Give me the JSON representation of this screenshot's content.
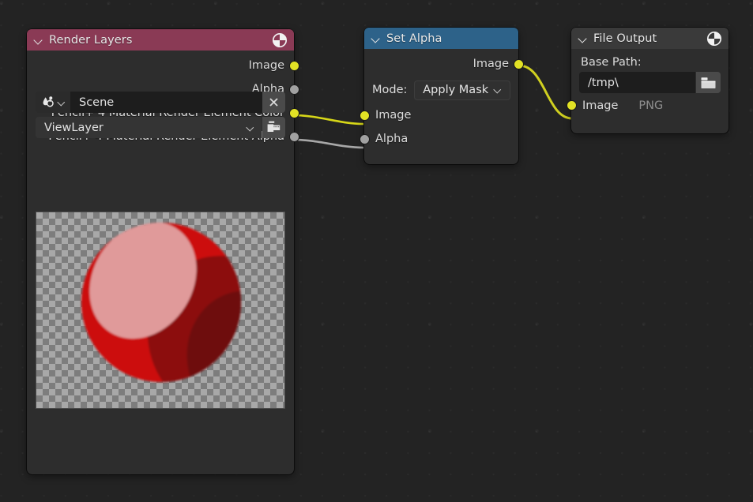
{
  "editor": {
    "background_color": "#232323",
    "grid": "dot-grid"
  },
  "nodes": [
    {
      "id": "render-layers",
      "title": "Render Layers",
      "header_color": "#8a3a55",
      "header_icon": "render-result-icon",
      "outputs": [
        {
          "label": "Image",
          "color": "#e2e225"
        },
        {
          "label": "Alpha",
          "color": "#a1a1a1"
        },
        {
          "label": "Pencil+ 4 Material Render Element Color",
          "color": "#e2e225"
        },
        {
          "label": "Pencil+ 4 Material Render Element Alpha",
          "color": "#a1a1a1"
        }
      ],
      "preview": {
        "name": "render-preview-thumbnail",
        "description": "toon shaded red sphere on transparent checkerboard"
      },
      "scene_field": {
        "icon": "scene-datablock-icon",
        "value": "Scene",
        "clear_label": "×"
      },
      "viewlayer_field": {
        "value": "ViewLayer",
        "side_icon": "view-layer-icon"
      }
    },
    {
      "id": "set-alpha",
      "title": "Set Alpha",
      "header_color": "#2d6289",
      "outputs": [
        {
          "label": "Image",
          "color": "#e2e225"
        }
      ],
      "mode": {
        "label": "Mode:",
        "value": "Apply Mask"
      },
      "inputs": [
        {
          "label": "Image",
          "color": "#e2e225"
        },
        {
          "label": "Alpha",
          "color": "#a1a1a1"
        }
      ]
    },
    {
      "id": "file-output",
      "title": "File Output",
      "header_color": "#3a3a3a",
      "header_icon": "render-result-icon",
      "base_path": {
        "label": "Base Path:",
        "value": "/tmp\\",
        "browse_icon": "folder-icon"
      },
      "inputs": [
        {
          "label": "Image",
          "color": "#e2e225",
          "format": "PNG"
        }
      ]
    }
  ],
  "links": [
    {
      "from": "render-layers.Pencil+ 4 Material Render Element Color",
      "to": "set-alpha.Image",
      "color": "#d7d718"
    },
    {
      "from": "render-layers.Pencil+ 4 Material Render Element Alpha",
      "to": "set-alpha.Alpha",
      "color": "#a8a8a8"
    },
    {
      "from": "set-alpha.Image",
      "to": "file-output.Image",
      "color": "#cfcf20"
    }
  ],
  "sphere_colors": {
    "highlight": "#e09a9a",
    "midtone": "#cc0f0f",
    "shadow": "#8c0d10",
    "deep_shadow": "#6e0c0f"
  }
}
